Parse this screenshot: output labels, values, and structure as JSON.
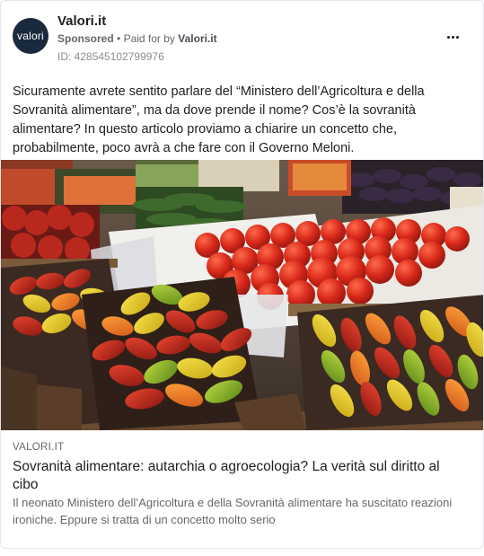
{
  "advertiser": {
    "avatar_text": "valori",
    "name": "Valori.it",
    "sponsored_label": "Sponsored",
    "separator": "•",
    "paid_for_prefix": "Paid for by",
    "paid_for_name": "Valori.it",
    "ad_id": "ID: 428545102799976"
  },
  "post": {
    "text": "Sicuramente avrete sentito parlare del “Ministero dell’Agricoltura e della Sovranità alimentare”, ma da dove prende il nome? Cos’è la sovranità alimentare? In questo articolo proviamo a chiarire un concetto che, probabilmente, poco avrà a che fare con il Governo Meloni."
  },
  "link": {
    "domain": "VALORI.IT",
    "title": "Sovranità alimentare: autarchia o agroecologia? La verità sul diritto al cibo",
    "description": "Il neonato Ministero dell’Agricoltura e della Sovranità alimentare ha suscitato reazioni ironiche. Eppure si tratta di un concetto molto serio"
  },
  "colors": {
    "avatar_bg": "#1a2a3e",
    "text_primary": "#1c1e21",
    "text_secondary": "#65676b",
    "border": "#e4e6eb"
  },
  "icons": {
    "more": "more-horizontal-icon"
  }
}
